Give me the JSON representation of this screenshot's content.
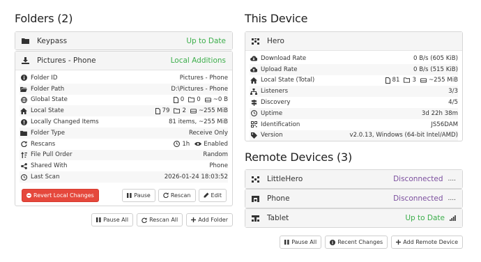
{
  "folders": {
    "title": "Folders (2)",
    "keypass": {
      "name": "Keypass",
      "status": "Up to Date"
    },
    "pictures": {
      "name": "Pictures - Phone",
      "status": "Local Additions",
      "rows": [
        {
          "label": "Folder ID",
          "value": "Pictures - Phone"
        },
        {
          "label": "Folder Path",
          "value": "D:\\Pictures - Phone"
        },
        {
          "label": "Global State",
          "files": "0",
          "dirs": "0",
          "size": "~0 B"
        },
        {
          "label": "Local State",
          "files": "79",
          "dirs": "2",
          "size": "~255 MiB"
        },
        {
          "label": "Locally Changed Items",
          "value": "81 items, ~255 MiB"
        },
        {
          "label": "Folder Type",
          "value": "Receive Only"
        },
        {
          "label": "Rescans",
          "interval": "1h",
          "enabled": "Enabled"
        },
        {
          "label": "File Pull Order",
          "value": "Random"
        },
        {
          "label": "Shared With",
          "value": "Phone"
        },
        {
          "label": "Last Scan",
          "value": "2026-01-24 18:03:52"
        }
      ],
      "buttons": {
        "revert": "Revert Local Changes",
        "pause": "Pause",
        "rescan": "Rescan",
        "edit": "Edit"
      }
    },
    "actions": {
      "pause_all": "Pause All",
      "rescan_all": "Rescan All",
      "add_folder": "Add Folder"
    }
  },
  "device": {
    "title": "This Device",
    "name": "Hero",
    "rows": [
      {
        "label": "Download Rate",
        "value": "0 B/s (605 KiB)"
      },
      {
        "label": "Upload Rate",
        "value": "0 B/s (515 KiB)"
      },
      {
        "label": "Local State (Total)",
        "files": "81",
        "dirs": "3",
        "size": "~255 MiB"
      },
      {
        "label": "Listeners",
        "value": "3/3"
      },
      {
        "label": "Discovery",
        "value": "4/5"
      },
      {
        "label": "Uptime",
        "value": "3d 22h 38m"
      },
      {
        "label": "Identification",
        "value": "JS56DAM"
      },
      {
        "label": "Version",
        "value": "v2.0.13, Windows (64-bit Intel/AMD)"
      }
    ]
  },
  "remote": {
    "title": "Remote Devices (3)",
    "devices": [
      {
        "name": "LittleHero",
        "status": "Disconnected",
        "extra": "...."
      },
      {
        "name": "Phone",
        "status": "Disconnected",
        "extra": "...."
      },
      {
        "name": "Tablet",
        "status": "Up to Date"
      }
    ],
    "actions": {
      "pause_all": "Pause All",
      "recent_changes": "Recent Changes",
      "add_remote": "Add Remote Device"
    }
  },
  "colors": {
    "green": "#3cae4b",
    "purple": "#7b4f9e",
    "blue": "#3a8fd2",
    "danger": "#e5483c"
  }
}
